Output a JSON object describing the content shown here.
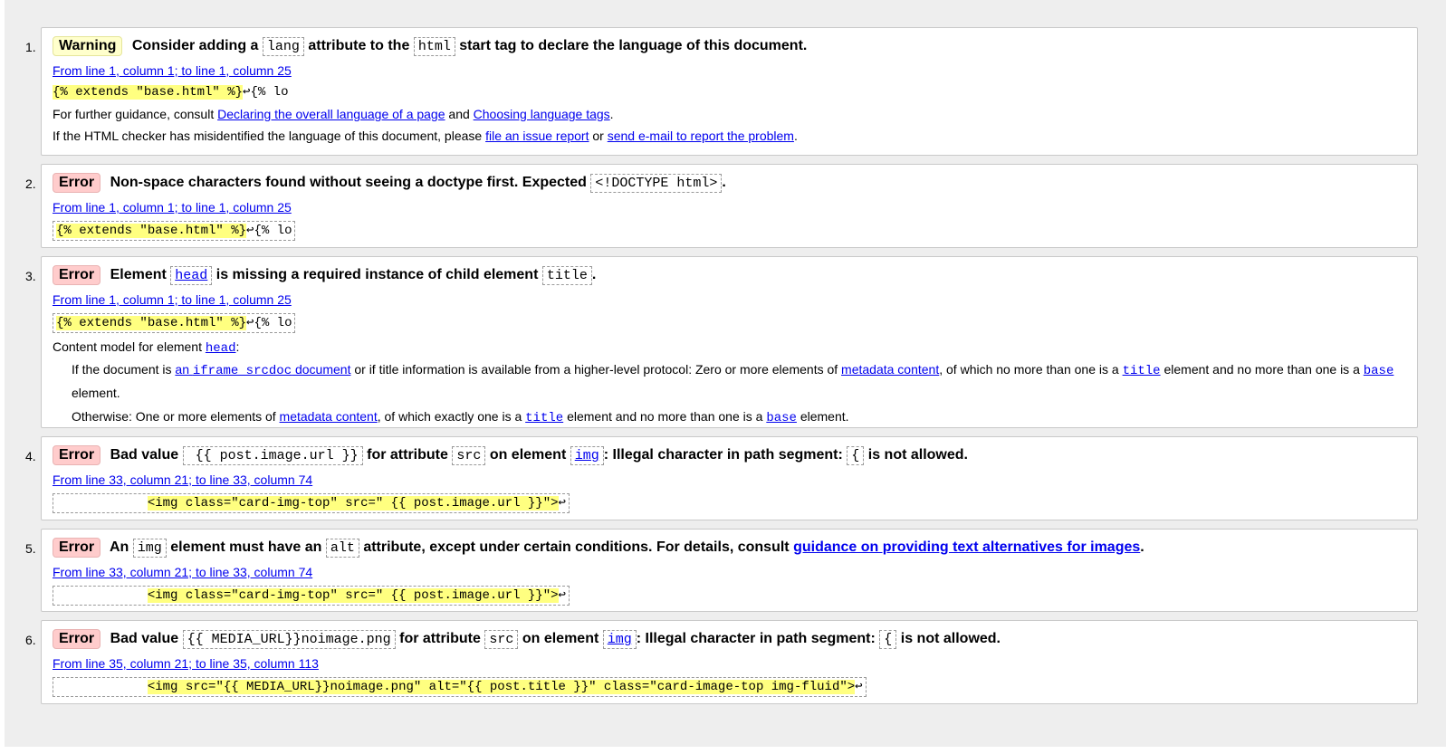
{
  "messages": [
    {
      "num": "1.",
      "badge": "Warning",
      "title": {
        "a": "Consider adding a",
        "lang": "lang",
        "b": "attribute to the",
        "html": "html",
        "c": "start tag to declare the language of this document."
      },
      "location": "From line 1, column 1; to line 1, column 25",
      "extract_hl": "{% extends \"base.html\" %}",
      "extract_tail": "↩{% lo",
      "guidance": {
        "prefix": "For further guidance, consult",
        "link1": "Declaring the overall language of a page",
        "and": "and",
        "link2": "Choosing language tags",
        "end": "."
      },
      "misid": {
        "prefix": "If the HTML checker has misidentified the language of this document, please",
        "link1": "file an issue report",
        "or": "or",
        "link2": "send e-mail to report the problem",
        "end": "."
      }
    },
    {
      "num": "2.",
      "badge": "Error",
      "title": {
        "a": "Non-space characters found without seeing a doctype first. Expected",
        "code": "<!DOCTYPE html>",
        "end": "."
      },
      "location": "From line 1, column 1; to line 1, column 25",
      "extract_hl": "{% extends \"base.html\" %}",
      "extract_tail": "↩{% lo"
    },
    {
      "num": "3.",
      "badge": "Error",
      "title": {
        "a": "Element",
        "head": "head",
        "b": "is missing a required instance of child element",
        "title": "title",
        "end": "."
      },
      "location": "From line 1, column 1; to line 1, column 25",
      "extract_hl": "{% extends \"base.html\" %}",
      "extract_tail": "↩{% lo",
      "content_model": {
        "prefix": "Content model for element",
        "head": "head",
        "colon": ":",
        "line1": {
          "a": "If the document is",
          "link": "an iframe srcdoc document",
          "link_pre": "an ",
          "link_code": "iframe srcdoc",
          "link_post": " document",
          "b": "or if title information is available from a higher-level protocol: Zero or more elements of",
          "meta": "metadata content",
          "c": ", of which no more than one is a",
          "title": "title",
          "d": "element and no more than one is a",
          "base": "base",
          "e": "element."
        },
        "line2": {
          "a": "Otherwise: One or more elements of",
          "meta": "metadata content",
          "b": ", of which exactly one is a",
          "title": "title",
          "c": "element and no more than one is a",
          "base": "base",
          "d": "element."
        }
      }
    },
    {
      "num": "4.",
      "badge": "Error",
      "title": {
        "a": "Bad value",
        "value": " {{ post.image.url }}",
        "b": "for attribute",
        "src": "src",
        "c": "on element",
        "img": "img",
        "d": ": Illegal character in path segment:",
        "ch": "{",
        "e": "is not allowed."
      },
      "location": "From line 33, column 21; to line 33, column 74",
      "extract_pre": "            ",
      "extract_hl": "<img class=\"card-img-top\" src=\" {{ post.image.url }}\">",
      "extract_tail": "↩"
    },
    {
      "num": "5.",
      "badge": "Error",
      "title": {
        "a": "An",
        "img": "img",
        "b": "element must have an",
        "alt": "alt",
        "c": "attribute, except under certain conditions. For details, consult",
        "link": "guidance on providing text alternatives for images",
        "end": "."
      },
      "location": "From line 33, column 21; to line 33, column 74",
      "extract_pre": "            ",
      "extract_hl": "<img class=\"card-img-top\" src=\" {{ post.image.url }}\">",
      "extract_tail": "↩"
    },
    {
      "num": "6.",
      "badge": "Error",
      "title": {
        "a": "Bad value",
        "value": "{{ MEDIA_URL}}noimage.png",
        "b": "for attribute",
        "src": "src",
        "c": "on element",
        "img": "img",
        "d": ": Illegal character in path segment:",
        "ch": "{",
        "e": "is not allowed."
      },
      "location": "From line 35, column 21; to line 35, column 113",
      "extract_pre": "            ",
      "extract_hl": "<img src=\"{{ MEDIA_URL}}noimage.png\" alt=\"{{ post.title }}\" class=\"card-image-top img-fluid\">",
      "extract_tail": "↩"
    }
  ]
}
